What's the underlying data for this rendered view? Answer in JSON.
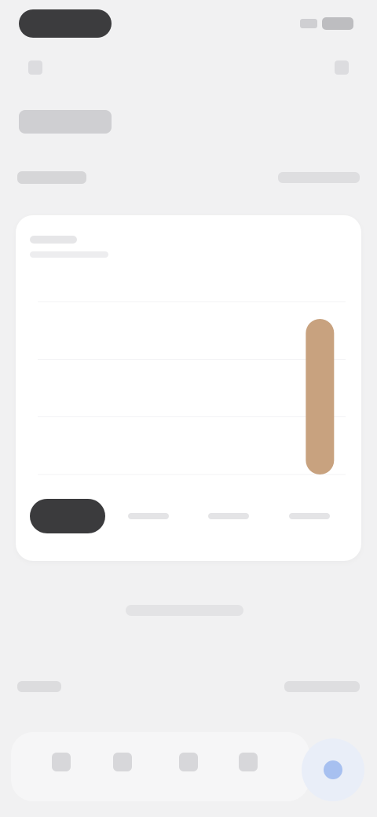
{
  "status_bar": {
    "time": "",
    "battery": ""
  },
  "top_bar": {
    "left_icon": "back-icon",
    "right_icon": "more-icon",
    "title": ""
  },
  "section": {
    "title": "",
    "action": ""
  },
  "chart_card": {
    "summary_label": "",
    "summary_value": "",
    "bar_color": "#c8a27f",
    "segments": [
      {
        "label": ""
      },
      {
        "label": ""
      },
      {
        "label": ""
      },
      {
        "label": ""
      }
    ]
  },
  "middle_text": "",
  "section2": {
    "title": "",
    "action": ""
  },
  "bottom_nav": {
    "items": [
      {
        "icon": "home-icon"
      },
      {
        "icon": "stats-icon"
      },
      {
        "icon": "center-icon"
      },
      {
        "icon": "profile-icon"
      }
    ],
    "fab_icon": "plus-icon",
    "fab_color": "#a7c0f0"
  },
  "chart_data": {
    "type": "bar",
    "categories": [
      "",
      "",
      "",
      "",
      "",
      ""
    ],
    "values": [
      0,
      0,
      0,
      0,
      0,
      9
    ],
    "ylim": [
      0,
      10
    ],
    "xlabel": "",
    "ylabel": "",
    "title": ""
  }
}
